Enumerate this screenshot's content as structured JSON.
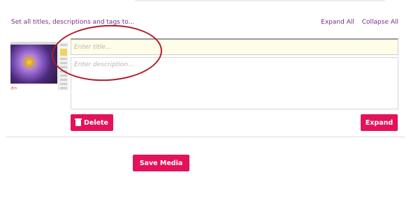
{
  "bulk_edit_link": "Set all titles, descriptions and tags to...",
  "header_links": {
    "expand_all": "Expand All",
    "collapse_all": "Collapse All"
  },
  "media_item": {
    "title_placeholder": "Enter title...",
    "description_placeholder": "Enter description...",
    "delete_label": "Delete",
    "expand_label": "Expand"
  },
  "save_label": "Save Media",
  "colors": {
    "accent": "#e3125a",
    "link": "#7b2a8e",
    "annotation": "#b01e2a"
  },
  "icons": {
    "delete": "trash-icon",
    "annotation_arrow": "arrow-left-icon"
  }
}
